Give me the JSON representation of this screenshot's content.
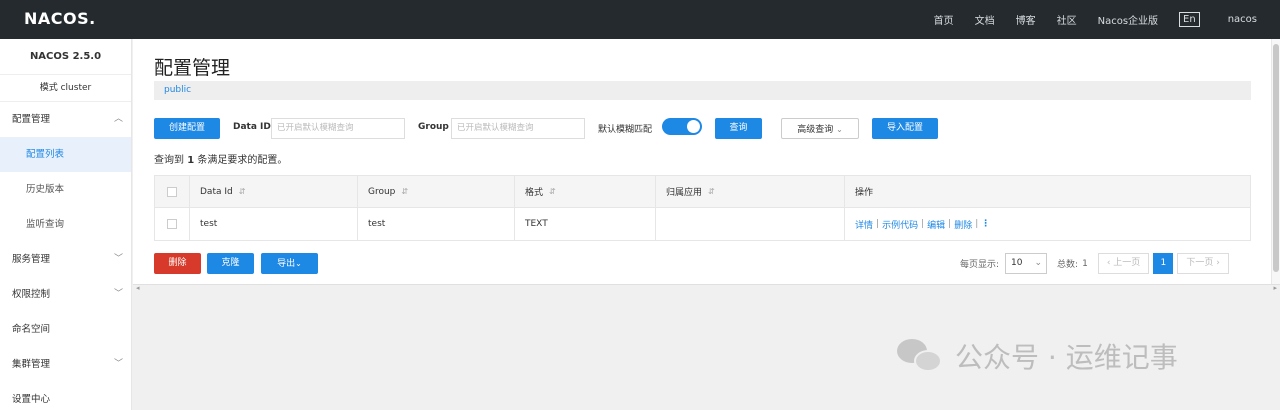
{
  "topbar": {
    "logo": "NACOS.",
    "nav": [
      "首页",
      "文档",
      "博客",
      "社区",
      "Nacos企业版"
    ],
    "lang": "En",
    "user": "nacos"
  },
  "sidebar": {
    "version": "NACOS 2.5.0",
    "mode": "模式 cluster",
    "items": [
      {
        "label": "配置管理"
      },
      {
        "label": "配置列表"
      },
      {
        "label": "历史版本"
      },
      {
        "label": "监听查询"
      },
      {
        "label": "服务管理"
      },
      {
        "label": "权限控制"
      },
      {
        "label": "命名空间"
      },
      {
        "label": "集群管理"
      },
      {
        "label": "设置中心"
      }
    ]
  },
  "main": {
    "title": "配置管理",
    "namespace": "public",
    "toolbar": {
      "create_label": "创建配置",
      "dataid_label": "Data ID",
      "dataid_placeholder": "已开启默认模糊查询",
      "group_label": "Group",
      "group_placeholder": "已开启默认模糊查询",
      "fuzzy_label": "默认模糊匹配",
      "fuzzy_on": true,
      "query_label": "查询",
      "advanced_label": "高级查询",
      "import_label": "导入配置"
    },
    "result": {
      "prefix": "查询到",
      "count": "1",
      "suffix": "条满足要求的配置。"
    },
    "table": {
      "columns": [
        "Data Id",
        "Group",
        "格式",
        "归属应用",
        "操作"
      ],
      "rows": [
        {
          "data_id": "test",
          "group": "test",
          "format": "TEXT",
          "app": ""
        }
      ],
      "ops": [
        "详情",
        "示例代码",
        "编辑",
        "删除"
      ]
    },
    "bottom": {
      "delete_label": "删除",
      "clone_label": "克隆",
      "export_label": "导出"
    },
    "pager": {
      "page_size_label": "每页显示:",
      "page_size": "10",
      "total_label": "总数:",
      "total": "1",
      "prev_label": "上一页",
      "current": "1",
      "next_label": "下一页"
    }
  },
  "watermark": {
    "text": "公众号 · 运维记事"
  },
  "colors": {
    "primary": "#1e88e5",
    "danger": "#d73a2a",
    "topbar": "#252a2f"
  }
}
